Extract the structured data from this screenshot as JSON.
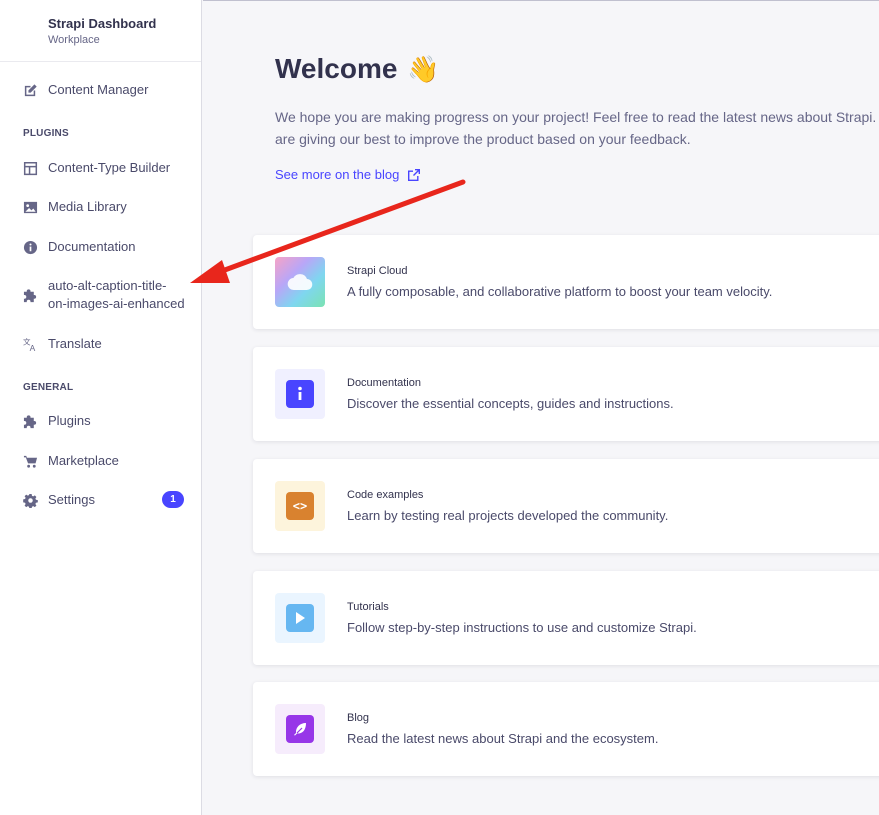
{
  "brand": {
    "title": "Strapi Dashboard",
    "subtitle": "Workplace"
  },
  "nav": {
    "content_manager": "Content Manager",
    "plugins_heading": "PLUGINS",
    "plugins": [
      {
        "label": "Content-Type Builder",
        "icon": "layout-icon"
      },
      {
        "label": "Media Library",
        "icon": "image-icon"
      },
      {
        "label": "Documentation",
        "icon": "info-icon"
      },
      {
        "label_line1": "auto-alt-caption-title-",
        "label_line2": "on-images-ai-enhanced",
        "icon": "puzzle-icon"
      },
      {
        "label": "Translate",
        "icon": "translate-icon"
      }
    ],
    "general_heading": "GENERAL",
    "general": [
      {
        "label": "Plugins",
        "icon": "puzzle-icon"
      },
      {
        "label": "Marketplace",
        "icon": "cart-icon"
      },
      {
        "label": "Settings",
        "icon": "gear-icon",
        "badge": "1"
      }
    ]
  },
  "main": {
    "title": "Welcome",
    "wave_emoji": "👋",
    "intro": "We hope you are making progress on your project! Feel free to read the latest news about Strapi. We are giving our best to improve the product based on your feedback.",
    "blog_link": "See more on the blog",
    "cards": [
      {
        "title": "Strapi Cloud",
        "description": "A fully composable, and collaborative platform to boost your team velocity.",
        "icon": "cloud-icon"
      },
      {
        "title": "Documentation",
        "description": "Discover the essential concepts, guides and instructions.",
        "icon": "info-icon",
        "color": "#4945ff",
        "bg": "#f0f0ff"
      },
      {
        "title": "Code examples",
        "description": "Learn by testing real projects developed the community.",
        "icon": "code-icon",
        "color": "#d9822f",
        "bg": "#fdf4dc"
      },
      {
        "title": "Tutorials",
        "description": "Follow step-by-step instructions to use and customize Strapi.",
        "icon": "play-icon",
        "color": "#66b7f1",
        "bg": "#eaf5ff"
      },
      {
        "title": "Blog",
        "description": "Read the latest news about Strapi and the ecosystem.",
        "icon": "feather-icon",
        "color": "#9736e8",
        "bg": "#f6ecfc"
      }
    ]
  },
  "annotation": {
    "arrow_color": "#e8261c"
  }
}
